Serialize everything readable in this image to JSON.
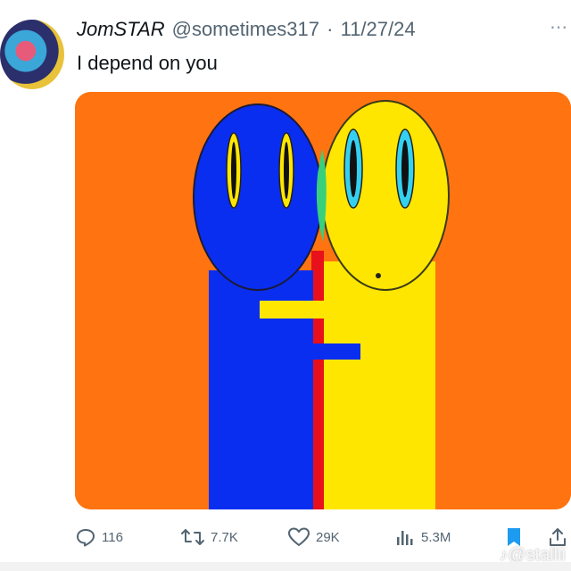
{
  "post": {
    "author_name": "JomSTAR",
    "handle": "@sometimes317",
    "separator": "·",
    "date": "11/27/24",
    "text": "I depend on you",
    "avatar_icon": "profile-avatar"
  },
  "media": {
    "background": "#ff7410",
    "left_figure_color": "#0a2ef0",
    "right_figure_color": "#ffe600",
    "gap_color": "#e8101a",
    "eye_color_left": "#ffe600",
    "eye_color_right": "#35d0f0"
  },
  "actions": {
    "replies": "116",
    "reposts": "7.7K",
    "likes": "29K",
    "views": "5.3M"
  },
  "watermark": "♪@stallii"
}
